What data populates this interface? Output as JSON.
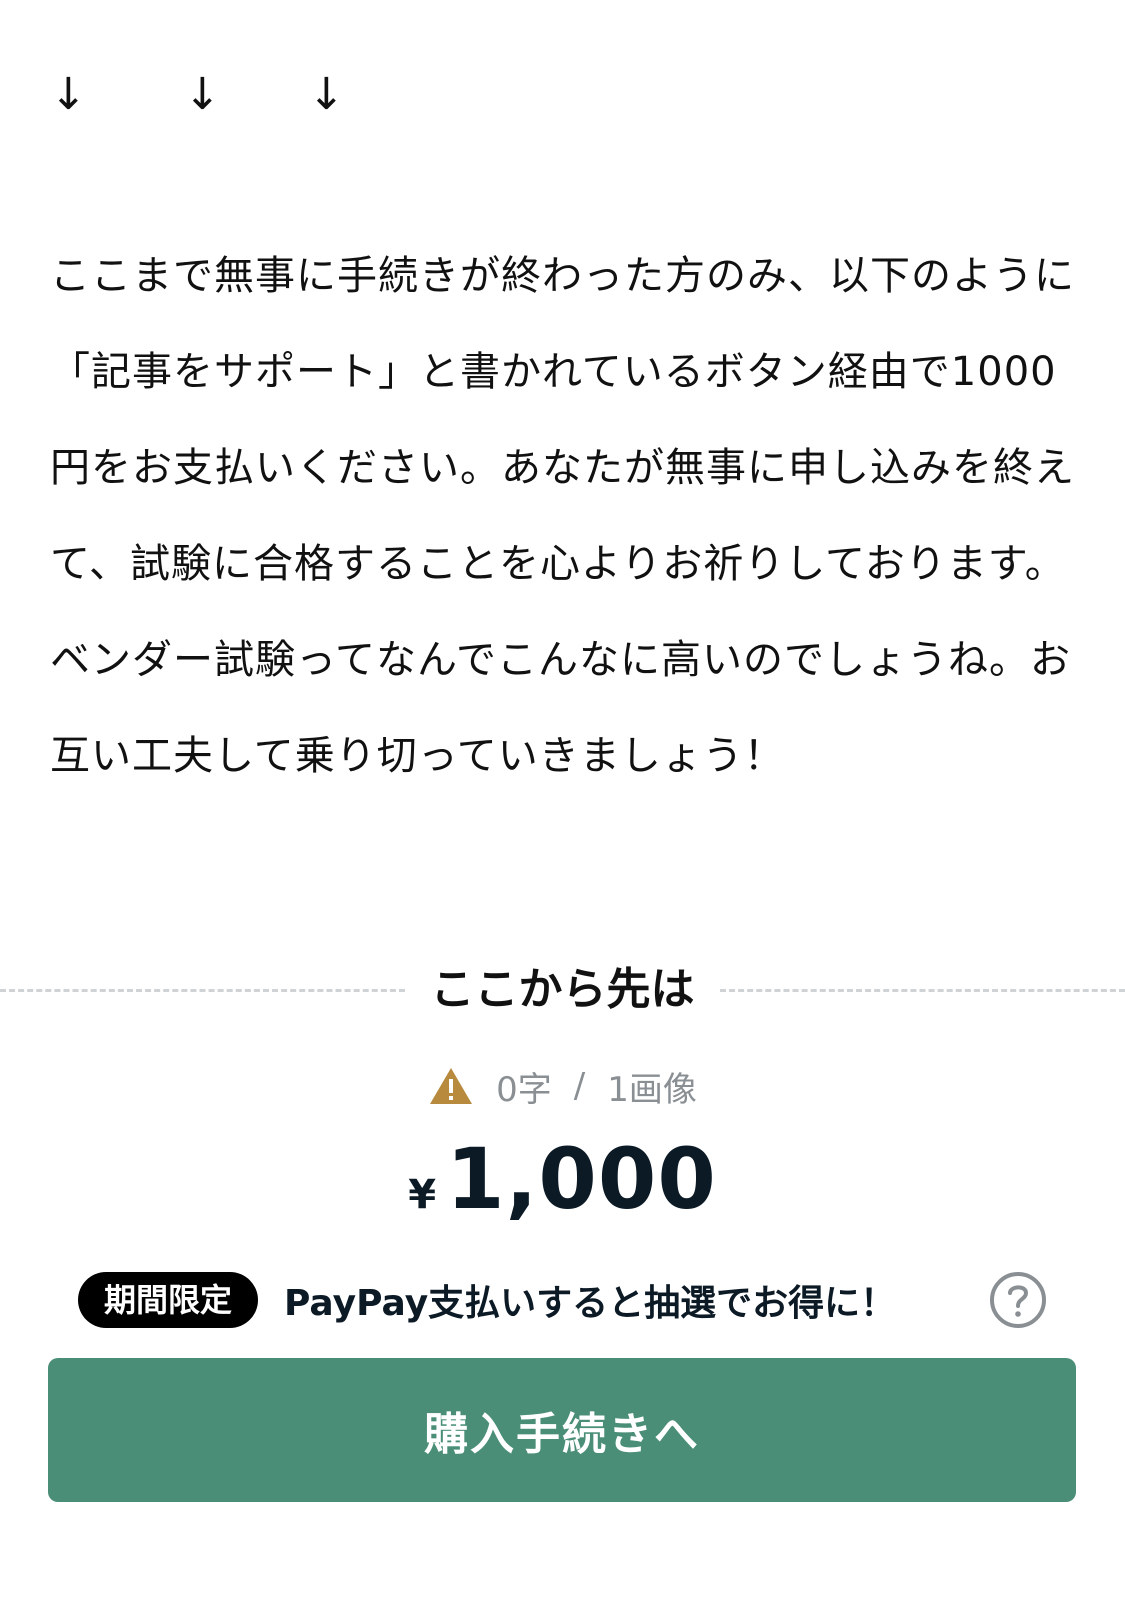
{
  "arrows": [
    "↓",
    "↓",
    "↓"
  ],
  "body": {
    "paragraph1": "ここまで無事に手続きが終わった方のみ、以下のように「記事をサポート」と書かれているボタン経由で1000円をお支払いください。あなたが無事に申し込みを終えて、試験に合格することを心よりお祈りしております。",
    "paragraph2": "ベンダー試験ってなんでこんなに高いのでしょうね。お互い工夫して乗り切っていきましょう！"
  },
  "paywall": {
    "divider_label": "ここから先は",
    "warning_icon": "warning-triangle-icon",
    "char_count": "0字",
    "separator": "/",
    "image_count": "1画像",
    "currency_symbol": "¥",
    "price": "1,000",
    "promo_badge": "期間限定",
    "promo_text": "PayPay支払いすると抽選でお得に！",
    "help_icon": "question-circle-icon",
    "buy_button_label": "購入手続きへ"
  },
  "colors": {
    "button_green": "#4a8e78",
    "warning_gold": "#b88a3e",
    "text_dark": "#0c1a26",
    "muted_gray": "#8a8f94"
  }
}
